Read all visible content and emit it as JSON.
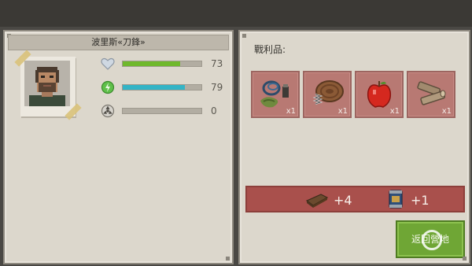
{
  "character": {
    "name": "波里斯«刀鋒»",
    "stats": [
      {
        "icon": "heart-icon",
        "value": "73",
        "fill": 0.73,
        "color": "#6fb82c"
      },
      {
        "icon": "energy-icon",
        "value": "79",
        "fill": 0.79,
        "color": "#33b4c6"
      },
      {
        "icon": "radiation-icon",
        "value": "0",
        "fill": 0.0,
        "color": "#9a9a9a"
      }
    ]
  },
  "loot": {
    "title": "戰利品:",
    "items": [
      {
        "icon": "rope-and-cloth-icon",
        "qty": "x1"
      },
      {
        "icon": "leather-and-spring-icon",
        "qty": "x1"
      },
      {
        "icon": "apple-icon",
        "qty": "x1"
      },
      {
        "icon": "wood-logs-icon",
        "qty": "x1"
      }
    ]
  },
  "rewards": [
    {
      "icon": "wood-plank-icon",
      "amount": "+4"
    },
    {
      "icon": "canned-food-icon",
      "amount": "+1"
    }
  ],
  "return_button": {
    "label": "返回營地"
  },
  "colors": {
    "panel": "#dcd7cc",
    "slot": "#b87973",
    "reward_bar": "#a9504c",
    "button": "#6fa635"
  }
}
